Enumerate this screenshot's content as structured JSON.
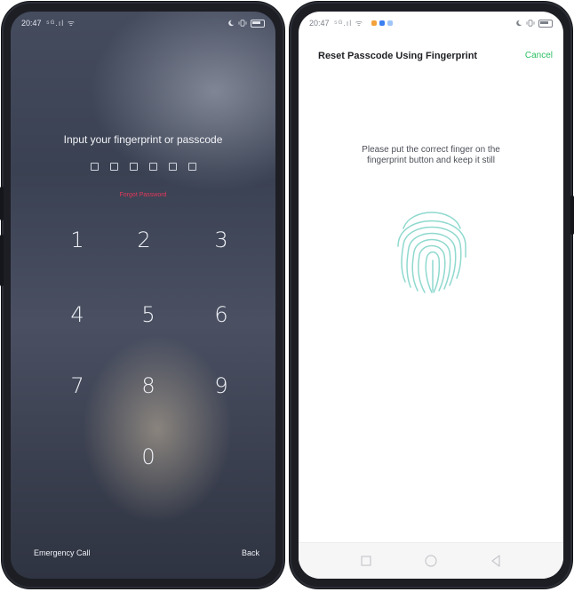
{
  "lock_screen": {
    "status": {
      "time": "20:47",
      "signal": "⁵ᴳ.ıl ᯤ"
    },
    "prompt": "Input your fingerprint or passcode",
    "pin_length": 6,
    "forgot_label": "Forgot Password",
    "keypad": [
      "1",
      "2",
      "3",
      "4",
      "5",
      "6",
      "7",
      "8",
      "9",
      "0"
    ],
    "emergency_label": "Emergency Call",
    "back_label": "Back"
  },
  "reset_screen": {
    "status": {
      "time": "20:47",
      "signal": "⁵ᴳ.ıl ᯤ"
    },
    "title": "Reset Passcode Using Fingerprint",
    "cancel_label": "Cancel",
    "instruction_line1": "Please put the correct finger on the",
    "instruction_line2": "fingerprint button and keep it still",
    "nav": [
      "square-icon",
      "circle-icon",
      "triangle-back-icon"
    ]
  },
  "colors": {
    "accent_green": "#2cbf63",
    "forgot_red": "#e3385c",
    "fingerprint_teal": "#8fd9cf"
  }
}
